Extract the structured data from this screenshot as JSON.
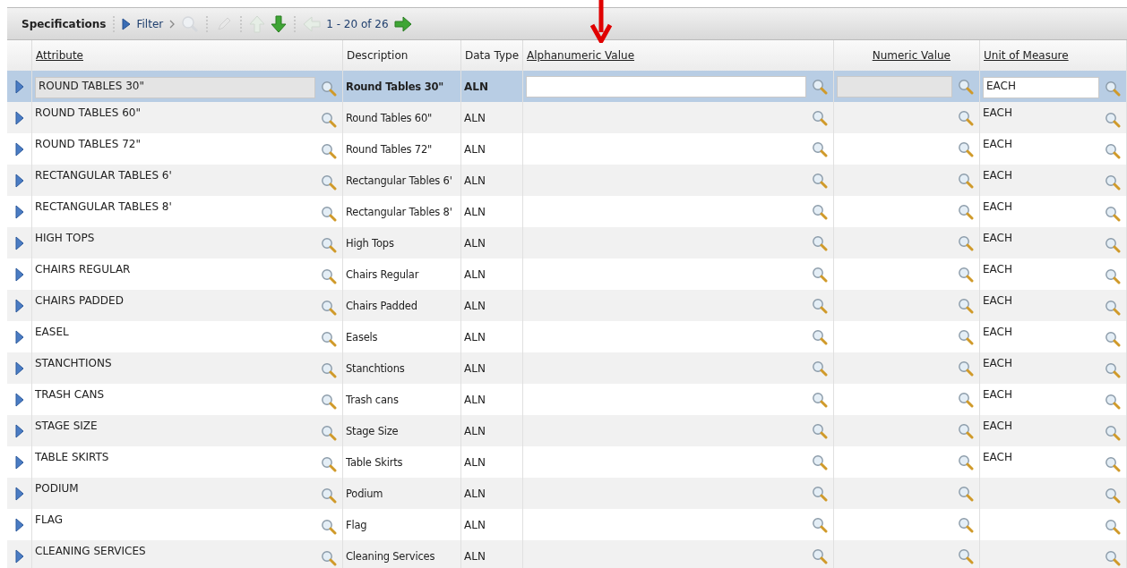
{
  "toolbar": {
    "title": "Specifications",
    "filter": "Filter",
    "pager": "1 - 20 of 26"
  },
  "columns": [
    {
      "label": "Attribute",
      "sortable": true
    },
    {
      "label": "Description",
      "sortable": false
    },
    {
      "label": "Data Type",
      "sortable": false
    },
    {
      "label": "Alphanumeric Value",
      "sortable": true
    },
    {
      "label": "Numeric Value",
      "sortable": true
    },
    {
      "label": "Unit of Measure",
      "sortable": true
    }
  ],
  "rows": [
    {
      "attribute": "ROUND TABLES 30\"",
      "description": "Round Tables 30\"",
      "data_type": "ALN",
      "unit": "EACH",
      "selected": true
    },
    {
      "attribute": "ROUND TABLES 60\"",
      "description": "Round Tables 60\"",
      "data_type": "ALN",
      "unit": "EACH",
      "selected": false
    },
    {
      "attribute": "ROUND TABLES 72\"",
      "description": "Round Tables 72\"",
      "data_type": "ALN",
      "unit": "EACH",
      "selected": false
    },
    {
      "attribute": "RECTANGULAR TABLES 6'",
      "description": "Rectangular Tables 6'",
      "data_type": "ALN",
      "unit": "EACH",
      "selected": false
    },
    {
      "attribute": "RECTANGULAR TABLES 8'",
      "description": "Rectangular Tables 8'",
      "data_type": "ALN",
      "unit": "EACH",
      "selected": false
    },
    {
      "attribute": "HIGH TOPS",
      "description": "High Tops",
      "data_type": "ALN",
      "unit": "EACH",
      "selected": false
    },
    {
      "attribute": "CHAIRS REGULAR",
      "description": "Chairs Regular",
      "data_type": "ALN",
      "unit": "EACH",
      "selected": false
    },
    {
      "attribute": "CHAIRS PADDED",
      "description": "Chairs Padded",
      "data_type": "ALN",
      "unit": "EACH",
      "selected": false
    },
    {
      "attribute": "EASEL",
      "description": "Easels",
      "data_type": "ALN",
      "unit": "EACH",
      "selected": false
    },
    {
      "attribute": "STANCHTIONS",
      "description": "Stanchtions",
      "data_type": "ALN",
      "unit": "EACH",
      "selected": false
    },
    {
      "attribute": "TRASH CANS",
      "description": "Trash cans",
      "data_type": "ALN",
      "unit": "EACH",
      "selected": false
    },
    {
      "attribute": "STAGE SIZE",
      "description": "Stage Size",
      "data_type": "ALN",
      "unit": "EACH",
      "selected": false
    },
    {
      "attribute": "TABLE SKIRTS",
      "description": "Table Skirts",
      "data_type": "ALN",
      "unit": "EACH",
      "selected": false
    },
    {
      "attribute": "PODIUM",
      "description": "Podium",
      "data_type": "ALN",
      "selected": false
    },
    {
      "attribute": "FLAG",
      "description": "Flag",
      "data_type": "ALN",
      "selected": false
    },
    {
      "attribute": "CLEANING SERVICES",
      "description": "Cleaning Services",
      "data_type": "ALN",
      "selected": false
    }
  ]
}
